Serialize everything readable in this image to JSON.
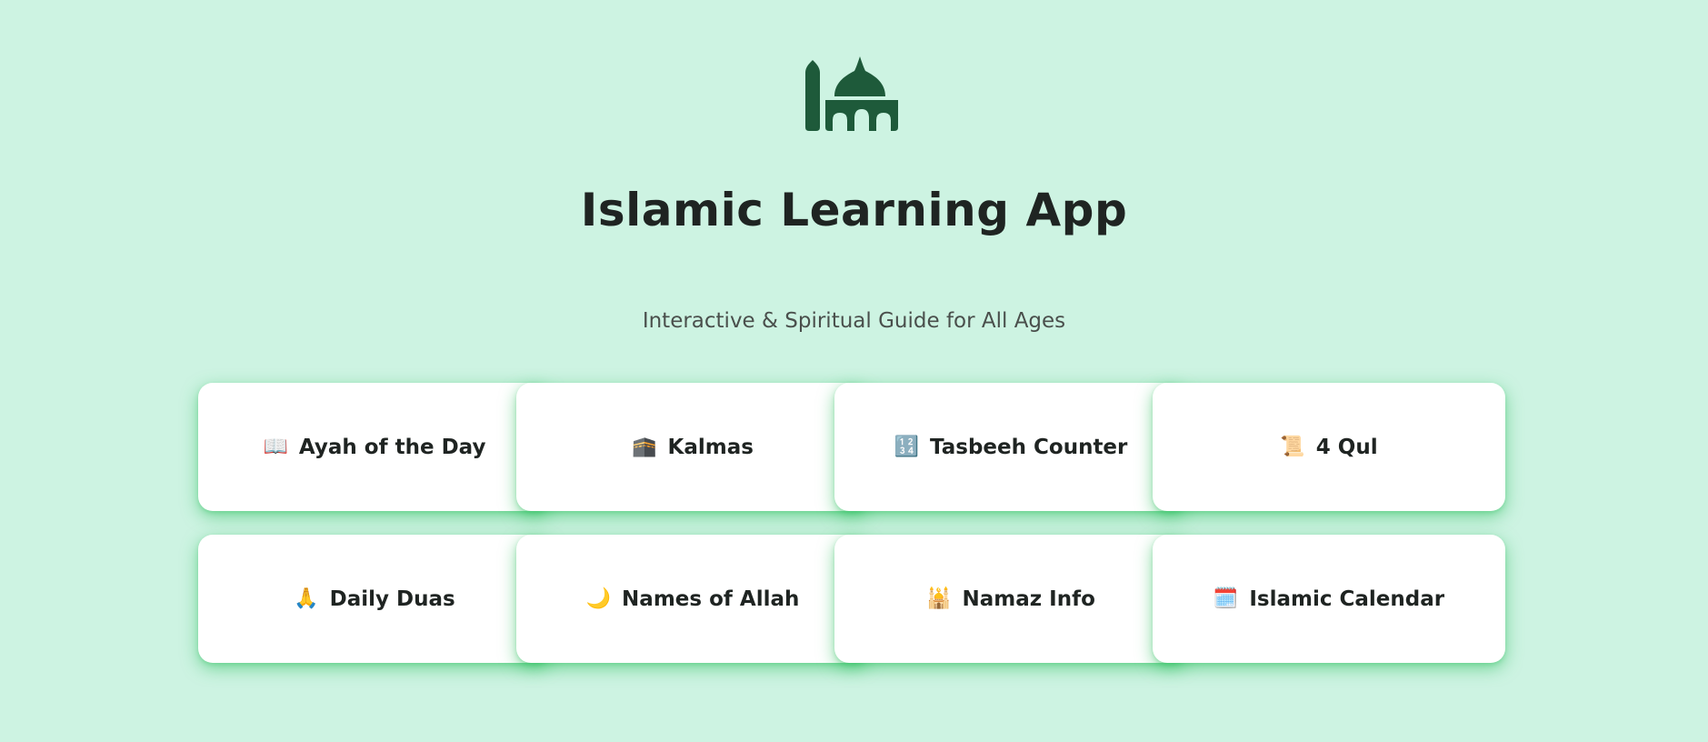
{
  "header": {
    "logo_icon": "mosque-icon",
    "logo_color": "#1e5a3a",
    "title": "Islamic Learning App",
    "subtitle": "Interactive & Spiritual Guide for All Ages"
  },
  "cards": [
    {
      "icon": "open-book-icon",
      "emoji": "📖",
      "label": "Ayah of the Day"
    },
    {
      "icon": "kaaba-icon",
      "emoji": "🕋",
      "label": "Kalmas"
    },
    {
      "icon": "counter-icon",
      "emoji": "🔢",
      "label": "Tasbeeh Counter"
    },
    {
      "icon": "scroll-icon",
      "emoji": "📜",
      "label": "4 Qul"
    },
    {
      "icon": "praying-hands-icon",
      "emoji": "🙏",
      "label": "Daily Duas"
    },
    {
      "icon": "crescent-moon-icon",
      "emoji": "🌙",
      "label": "Names of Allah"
    },
    {
      "icon": "mosque-icon",
      "emoji": "🕌",
      "label": "Namaz Info"
    },
    {
      "icon": "calendar-icon",
      "emoji": "🗓️",
      "label": "Islamic Calendar"
    }
  ],
  "colors": {
    "background": "#cdf3e2",
    "card": "#ffffff",
    "card_glow": "#28be5a",
    "text": "#1f2422"
  }
}
